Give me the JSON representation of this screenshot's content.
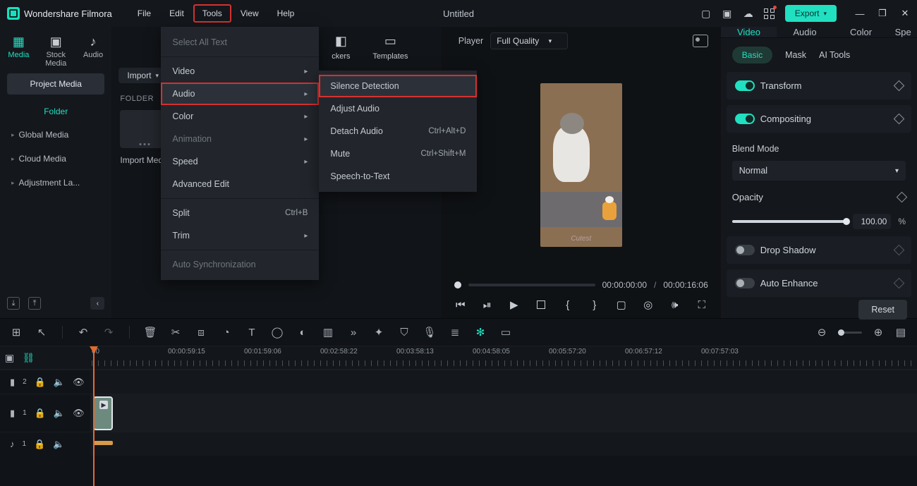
{
  "app": {
    "name": "Wondershare Filmora",
    "doc_title": "Untitled"
  },
  "menubar": [
    "File",
    "Edit",
    "Tools",
    "View",
    "Help"
  ],
  "export_label": "Export",
  "source_tabs": [
    {
      "label": "Media",
      "icon": "▦"
    },
    {
      "label": "Stock Media",
      "icon": "▣"
    },
    {
      "label": "Audio",
      "icon": "♪"
    }
  ],
  "project_media_label": "Project Media",
  "folder_label": "Folder",
  "side_items": [
    "Global Media",
    "Cloud Media",
    "Adjustment La..."
  ],
  "import_label": "Import",
  "folder_header": "FOLDER",
  "thumb_label": "Import Media",
  "bin_extra_tabs": [
    {
      "label": "ckers",
      "icon": "◧"
    },
    {
      "label": "Templates",
      "icon": "▭"
    }
  ],
  "tools_menu": [
    {
      "label": "Select All Text",
      "disabled": true
    },
    {
      "sep": true
    },
    {
      "label": "Video",
      "arrow": true
    },
    {
      "label": "Audio",
      "arrow": true,
      "highlight": true
    },
    {
      "label": "Color",
      "arrow": true
    },
    {
      "label": "Animation",
      "arrow": true,
      "disabled": true
    },
    {
      "label": "Speed",
      "arrow": true
    },
    {
      "label": "Advanced Edit"
    },
    {
      "sep": true
    },
    {
      "label": "Split",
      "shortcut": "Ctrl+B"
    },
    {
      "label": "Trim",
      "arrow": true
    },
    {
      "sep": true
    },
    {
      "label": "Auto Synchronization",
      "disabled": true
    }
  ],
  "audio_submenu": [
    {
      "label": "Silence Detection",
      "highlight": true
    },
    {
      "label": "Adjust Audio"
    },
    {
      "label": "Detach Audio",
      "shortcut": "Ctrl+Alt+D"
    },
    {
      "label": "Mute",
      "shortcut": "Ctrl+Shift+M"
    },
    {
      "label": "Speech-to-Text"
    }
  ],
  "preview": {
    "player_label": "Player",
    "quality": "Full Quality",
    "frame_caption": "Cutest",
    "cur_time": "00:00:00:00",
    "dur": "00:00:16:06"
  },
  "right": {
    "tabs": [
      "Video",
      "Audio",
      "Color",
      "Spe"
    ],
    "subtabs": [
      "Basic",
      "Mask",
      "AI Tools"
    ],
    "transform": "Transform",
    "compositing": "Compositing",
    "blend_label": "Blend Mode",
    "blend_value": "Normal",
    "opacity_label": "Opacity",
    "opacity_value": "100.00",
    "opacity_unit": "%",
    "drop_shadow": "Drop Shadow",
    "auto_enhance": "Auto Enhance",
    "reset": "Reset"
  },
  "ruler_labels": [
    "00",
    "00:00:59:15",
    "00:01:59:06",
    "00:02:58:22",
    "00:03:58:13",
    "00:04:58:05",
    "00:05:57:20",
    "00:06:57:12",
    "00:07:57:03"
  ],
  "track_ids": [
    "2",
    "1",
    "1"
  ]
}
